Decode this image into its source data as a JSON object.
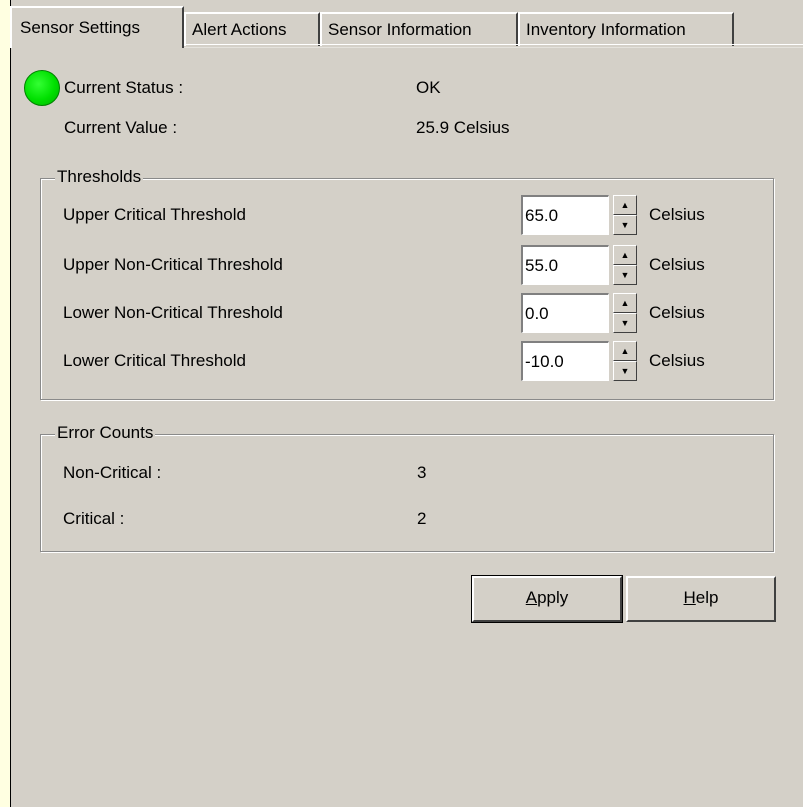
{
  "tabs": [
    {
      "label": "Sensor Settings",
      "active": true
    },
    {
      "label": "Alert Actions",
      "active": false
    },
    {
      "label": "Sensor Information",
      "active": false
    },
    {
      "label": "Inventory Information",
      "active": false
    }
  ],
  "status": {
    "status_label": "Current Status :",
    "status_value": "OK",
    "value_label": "Current Value :",
    "value_value": "25.9 Celsius",
    "led_color": "#00e000"
  },
  "thresholds": {
    "title": "Thresholds",
    "rows": [
      {
        "label": "Upper Critical Threshold",
        "value": "65.0",
        "unit": "Celsius"
      },
      {
        "label": "Upper Non-Critical Threshold",
        "value": "55.0",
        "unit": "Celsius"
      },
      {
        "label": "Lower Non-Critical Threshold",
        "value": "0.0",
        "unit": "Celsius"
      },
      {
        "label": "Lower Critical Threshold",
        "value": "-10.0",
        "unit": "Celsius"
      }
    ]
  },
  "errors": {
    "title": "Error Counts",
    "noncritical_label": "Non-Critical :",
    "noncritical_value": "3",
    "critical_label": "Critical :",
    "critical_value": "2"
  },
  "buttons": {
    "apply_pre": "",
    "apply_key": "A",
    "apply_post": "pply",
    "help_pre": "",
    "help_key": "H",
    "help_post": "elp"
  }
}
